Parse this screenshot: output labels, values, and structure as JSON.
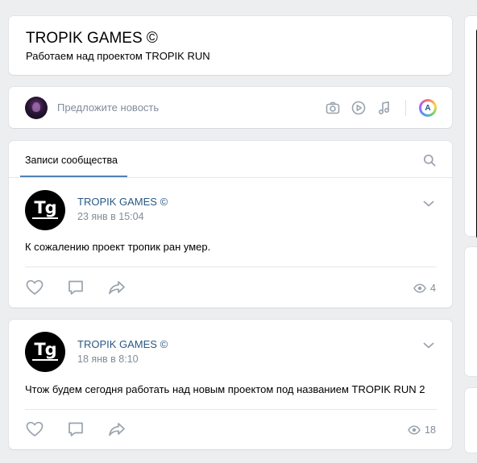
{
  "group": {
    "title": "TROPIK GAMES ©",
    "status": "Работаем над проектом TROPIK RUN"
  },
  "suggest": {
    "placeholder": "Предложите новость",
    "icons": [
      "camera-icon",
      "video-icon",
      "music-icon",
      "ai-assistant-icon"
    ],
    "ai_letter": "A"
  },
  "feed": {
    "tab": "Записи сообщества",
    "posts": [
      {
        "author": "TROPIK GAMES ©",
        "date": "23 янв в 15:04",
        "text": "К сожалению проект тропик ран умер.",
        "views": "4",
        "logo": "Tg"
      },
      {
        "author": "TROPIK GAMES ©",
        "date": "18 янв в 8:10",
        "text": "Чтож будем сегодня работать над новым проектом под названием TROPIK RUN 2",
        "views": "18",
        "logo": "Tg"
      }
    ]
  },
  "colors": {
    "background": "#edeef0",
    "link": "#2a5885",
    "muted": "#818c99",
    "accent": "#5181b8",
    "icon": "#99a2ad"
  }
}
